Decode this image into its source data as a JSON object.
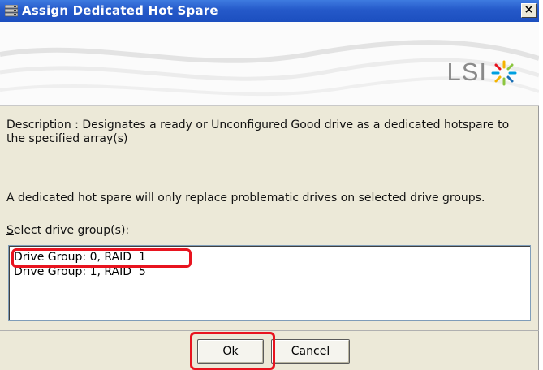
{
  "window": {
    "title": "Assign Dedicated Hot Spare",
    "close_glyph": "×",
    "app_icon": "server-stack-icon"
  },
  "banner": {
    "logo_text": "LSI",
    "logo_icon": "lsi-starburst-icon"
  },
  "content": {
    "description": "Description : Designates a ready or Unconfigured Good drive as a dedicated hotspare to the specified array(s)",
    "note": "A dedicated hot spare will only replace problematic drives on selected drive groups.",
    "select_label_mnemonic": "S",
    "select_label_rest": "elect drive group(s):"
  },
  "drive_groups": [
    "Drive Group: 0, RAID  1",
    "Drive Group: 1, RAID  5"
  ],
  "buttons": {
    "ok": "Ok",
    "cancel": "Cancel"
  },
  "colors": {
    "titlebar": "#2559c9",
    "highlight": "#e8141f",
    "dialog_bg": "#ece9d8"
  }
}
